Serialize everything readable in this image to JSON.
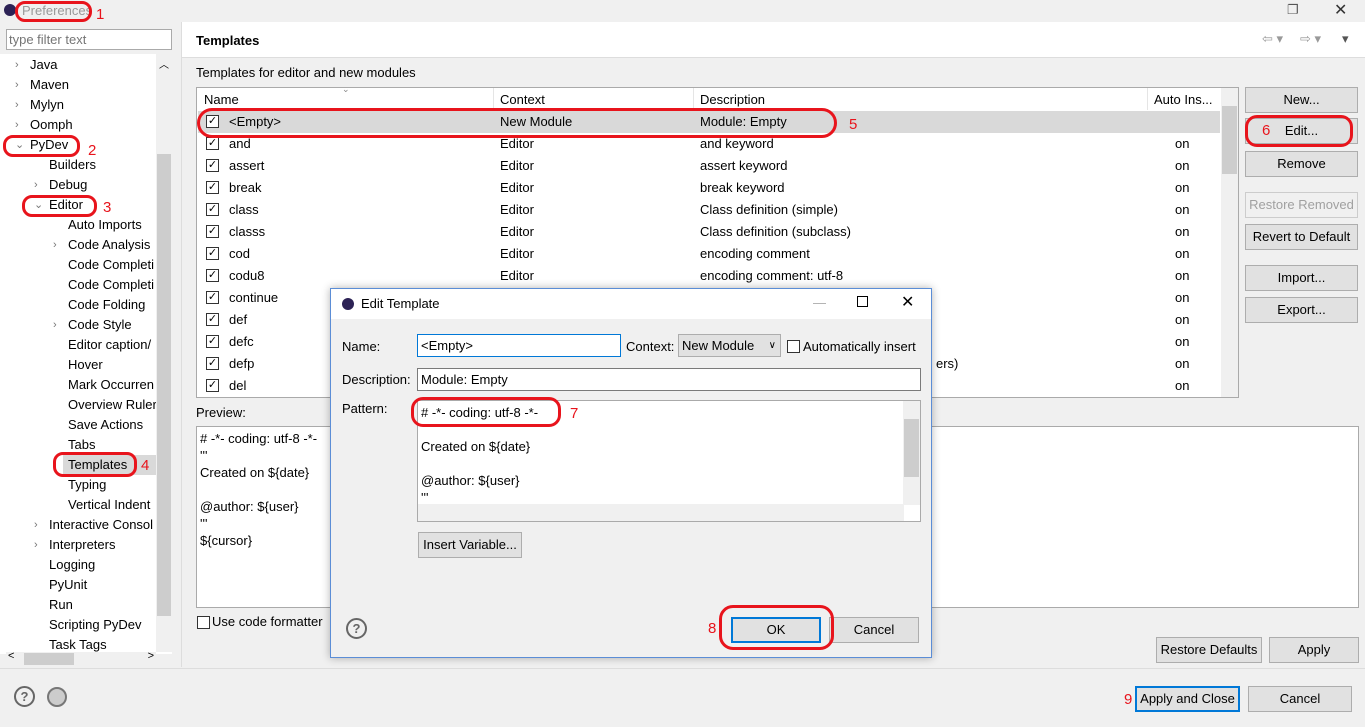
{
  "window": {
    "title": "Preferences",
    "restore_icon": "restore-icon",
    "close_icon": "close-icon"
  },
  "filter": {
    "placeholder": "type filter text"
  },
  "tree": [
    {
      "label": "Java",
      "level": 0,
      "exp": ">"
    },
    {
      "label": "Maven",
      "level": 0,
      "exp": ">"
    },
    {
      "label": "Mylyn",
      "level": 0,
      "exp": ">"
    },
    {
      "label": "Oomph",
      "level": 0,
      "exp": ">"
    },
    {
      "label": "PyDev",
      "level": 0,
      "exp": "v"
    },
    {
      "label": "Builders",
      "level": 1,
      "exp": ""
    },
    {
      "label": "Debug",
      "level": 1,
      "exp": ">"
    },
    {
      "label": "Editor",
      "level": 1,
      "exp": "v"
    },
    {
      "label": "Auto Imports",
      "level": 2,
      "exp": ""
    },
    {
      "label": "Code Analysis",
      "level": 2,
      "exp": ">"
    },
    {
      "label": "Code Completi",
      "level": 2,
      "exp": ""
    },
    {
      "label": "Code Completi",
      "level": 2,
      "exp": ""
    },
    {
      "label": "Code Folding",
      "level": 2,
      "exp": ""
    },
    {
      "label": "Code Style",
      "level": 2,
      "exp": ">"
    },
    {
      "label": "Editor caption/",
      "level": 2,
      "exp": ""
    },
    {
      "label": "Hover",
      "level": 2,
      "exp": ""
    },
    {
      "label": "Mark Occurren",
      "level": 2,
      "exp": ""
    },
    {
      "label": "Overview Ruler",
      "level": 2,
      "exp": ""
    },
    {
      "label": "Save Actions",
      "level": 2,
      "exp": ""
    },
    {
      "label": "Tabs",
      "level": 2,
      "exp": ""
    },
    {
      "label": "Templates",
      "level": 2,
      "exp": "",
      "selected": true
    },
    {
      "label": "Typing",
      "level": 2,
      "exp": ""
    },
    {
      "label": "Vertical Indent",
      "level": 2,
      "exp": ""
    },
    {
      "label": "Interactive Consol",
      "level": 1,
      "exp": ">"
    },
    {
      "label": "Interpreters",
      "level": 1,
      "exp": ">"
    },
    {
      "label": "Logging",
      "level": 1,
      "exp": ""
    },
    {
      "label": "PyUnit",
      "level": 1,
      "exp": ""
    },
    {
      "label": "Run",
      "level": 1,
      "exp": ""
    },
    {
      "label": "Scripting PyDev",
      "level": 1,
      "exp": ""
    },
    {
      "label": "Task Tags",
      "level": 1,
      "exp": ""
    }
  ],
  "page": {
    "title": "Templates",
    "subtitle": "Templates for editor and new modules",
    "preview_label": "Preview:",
    "use_formatter": "Use code formatter"
  },
  "table": {
    "headers": [
      "Name",
      "Context",
      "Description",
      "Auto Ins..."
    ],
    "rows": [
      [
        "<Empty>",
        "New Module",
        "Module: Empty",
        ""
      ],
      [
        "and",
        "Editor",
        "and keyword",
        "on"
      ],
      [
        "assert",
        "Editor",
        "assert keyword",
        "on"
      ],
      [
        "break",
        "Editor",
        "break keyword",
        "on"
      ],
      [
        "class",
        "Editor",
        "Class definition (simple)",
        "on"
      ],
      [
        "classs",
        "Editor",
        "Class definition (subclass)",
        "on"
      ],
      [
        "cod",
        "Editor",
        "encoding comment",
        "on"
      ],
      [
        "codu8",
        "Editor",
        "encoding comment: utf-8",
        "on"
      ],
      [
        "continue",
        "",
        "",
        "on"
      ],
      [
        "def",
        "",
        "",
        "on"
      ],
      [
        "defc",
        "",
        "",
        "on"
      ],
      [
        "defp",
        "",
        "ers)",
        "on"
      ],
      [
        "del",
        "",
        "",
        "on"
      ]
    ]
  },
  "side_buttons": {
    "new": "New...",
    "edit": "Edit...",
    "remove": "Remove",
    "restore_removed": "Restore Removed",
    "revert": "Revert to Default",
    "import": "Import...",
    "export": "Export..."
  },
  "preview_lines": [
    "# -*- coding: utf-8 -*-",
    "'''",
    "Created on ${date}",
    "",
    "@author: ${user}",
    "'''",
    "${cursor}"
  ],
  "bottom": {
    "restore_defaults": "Restore Defaults",
    "apply": "Apply",
    "apply_close": "Apply and Close",
    "cancel": "Cancel"
  },
  "dialog": {
    "title": "Edit Template",
    "name_label": "Name:",
    "name_value": "<Empty>",
    "context_label": "Context:",
    "context_value": "New Module",
    "auto_insert": "Automatically insert",
    "desc_label": "Description:",
    "desc_value": "Module: Empty",
    "pattern_label": "Pattern:",
    "pattern_lines": [
      "# -*- coding: utf-8 -*-",
      "",
      "Created on ${date}",
      "",
      "@author: ${user}",
      "'''"
    ],
    "insert_variable": "Insert Variable...",
    "ok": "OK",
    "cancel": "Cancel"
  },
  "annotations": [
    "1",
    "2",
    "3",
    "4",
    "5",
    "6",
    "7",
    "8",
    "9"
  ],
  "colors": {
    "annotation": "#e8141c",
    "default_button_border": "#0078d7"
  }
}
